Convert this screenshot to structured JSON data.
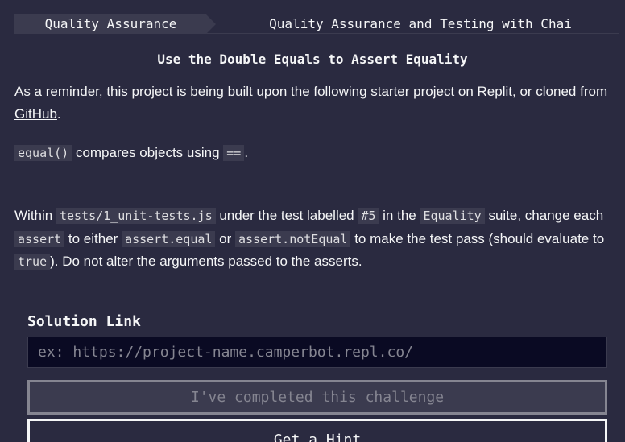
{
  "breadcrumb": {
    "section": "Quality Assurance",
    "course": "Quality Assurance and Testing with Chai"
  },
  "challenge": {
    "title": "Use the Double Equals to Assert Equality"
  },
  "intro": {
    "text_before": "As a reminder, this project is being built upon the following starter project on ",
    "replit_link": "Replit",
    "text_middle": ", or cloned from ",
    "github_link": "GitHub",
    "text_after": "."
  },
  "equal_note": {
    "code_equal": "equal()",
    "text_mid": " compares objects using ",
    "code_op": "==",
    "text_after": "."
  },
  "instructions": {
    "t1": "Within ",
    "c1": "tests/1_unit-tests.js",
    "t2": " under the test labelled ",
    "c2": "#5",
    "t3": " in the ",
    "c3": "Equality",
    "t4": " suite, change each ",
    "c4": "assert",
    "t5": " to either ",
    "c5": "assert.equal",
    "t6": " or ",
    "c6": "assert.notEqual",
    "t7": " to make the test pass (should evaluate to ",
    "c7": "true",
    "t8": "). Do not alter the arguments passed to the asserts."
  },
  "solution": {
    "label": "Solution Link",
    "placeholder": "ex: https://project-name.camperbot.repl.co/"
  },
  "buttons": {
    "complete": "I've completed this challenge",
    "hint": "Get a Hint"
  }
}
